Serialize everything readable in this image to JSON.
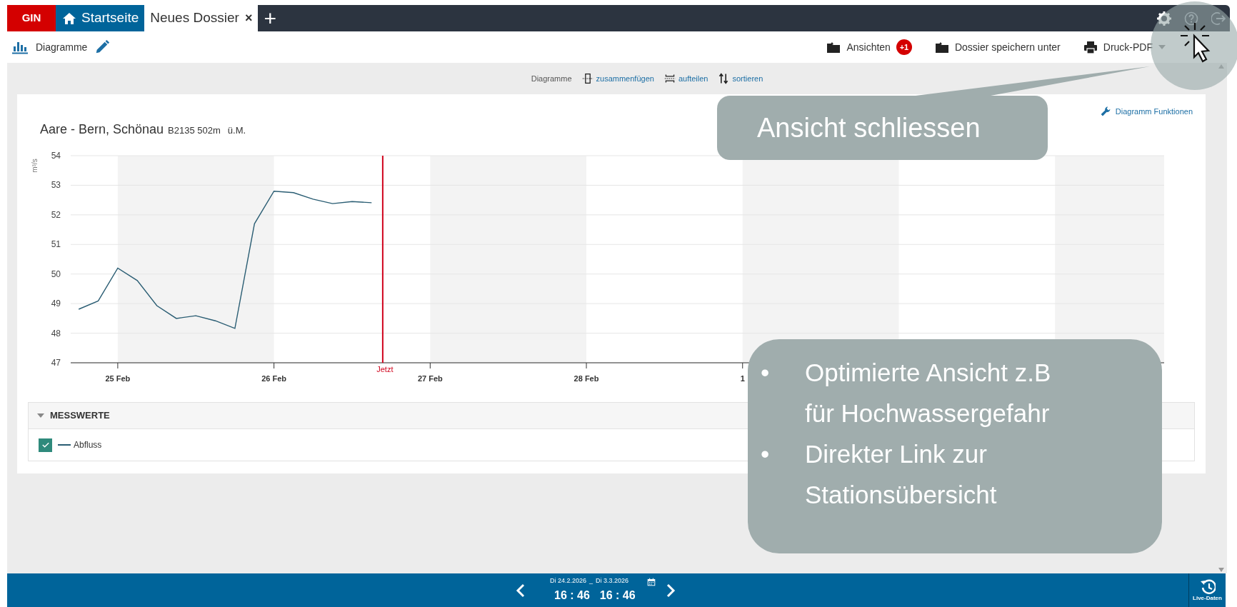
{
  "top_tabs": [
    {
      "label": "GIN",
      "kind": "brand",
      "selected": false
    },
    {
      "label": "Startseite",
      "kind": "home",
      "selected": false
    },
    {
      "label": "Neues Dossier",
      "kind": "document",
      "selected": true,
      "close_label": "×"
    }
  ],
  "add_tab_label": "+",
  "toolbar": {
    "title": "Diagramme",
    "actions": [
      {
        "label": "Ansichten",
        "kind": "views",
        "badge": "+1"
      },
      {
        "label": "Dossier speichern unter",
        "kind": "save"
      },
      {
        "label": "Druck-PDF",
        "kind": "print"
      }
    ]
  },
  "chart_toolbar": {
    "label": "Diagramme",
    "actions": [
      {
        "label": "zusammenfügen",
        "kind": "merge"
      },
      {
        "label": "aufteilen",
        "kind": "split"
      },
      {
        "label": "sortieren",
        "kind": "sort"
      }
    ]
  },
  "diagram": {
    "title": "Aare - Bern, Schönau",
    "station_info": "B2135 502m",
    "elevation": "ü.M.",
    "functions_label": "Diagramm Funktionen",
    "now_label": "Jetzt",
    "chart_data": {
      "type": "line",
      "ylabel": "m³/s",
      "grid": true,
      "ylim": [
        47,
        54
      ],
      "categories": [
        null,
        null,
        "25 Feb",
        null,
        null,
        null,
        null,
        null,
        null,
        null,
        "26 Feb",
        null,
        null,
        null,
        null,
        null,
        null,
        null,
        "27 Feb",
        null,
        null,
        null,
        null,
        null,
        null,
        null,
        "28 Feb",
        null,
        null,
        null,
        null,
        null,
        null,
        null,
        "1",
        null,
        null,
        null,
        null,
        null,
        null,
        null,
        null,
        null,
        null,
        null,
        null,
        null,
        null,
        null,
        null,
        null,
        null,
        null,
        null,
        null
      ],
      "yticks": [
        47,
        48,
        49,
        50,
        51,
        52,
        53,
        54
      ],
      "series": [
        {
          "name": "Abfluss",
          "color": "#2a5d73",
          "values": [
            48.81,
            49.09,
            50.2,
            49.78,
            48.93,
            48.5,
            48.59,
            48.42,
            48.16,
            51.7,
            52.8,
            52.75,
            52.53,
            52.38,
            52.45,
            52.41,
            null,
            null,
            null,
            null,
            null,
            null,
            null,
            null,
            null,
            null,
            null,
            null,
            null,
            null,
            null,
            null,
            null,
            null,
            null,
            null,
            null,
            null,
            null,
            null,
            null,
            null,
            null,
            null,
            null,
            null,
            null,
            null,
            null,
            null,
            null,
            null,
            null,
            null,
            null,
            null
          ]
        }
      ]
    }
  },
  "measurements": {
    "heading": "MESSWERTE",
    "expanded": true,
    "items": [
      {
        "checked": true
      }
    ]
  },
  "time_bar": {
    "start_date": "Di 24.2.2026",
    "separator": "_",
    "end_date": "Di 3.3.2026",
    "start_time": "16 : 46",
    "end_time": "16 : 46",
    "live_label": "Live-Daten"
  },
  "callouts": [
    {
      "kind": "label",
      "text": "Ansicht schliessen"
    },
    {
      "kind": "bullets",
      "bullet": "•",
      "items": [
        "Optimierte Ansicht z.B für Hochwassergefahr",
        "Direkter Link zur Stationsübersicht"
      ]
    }
  ]
}
